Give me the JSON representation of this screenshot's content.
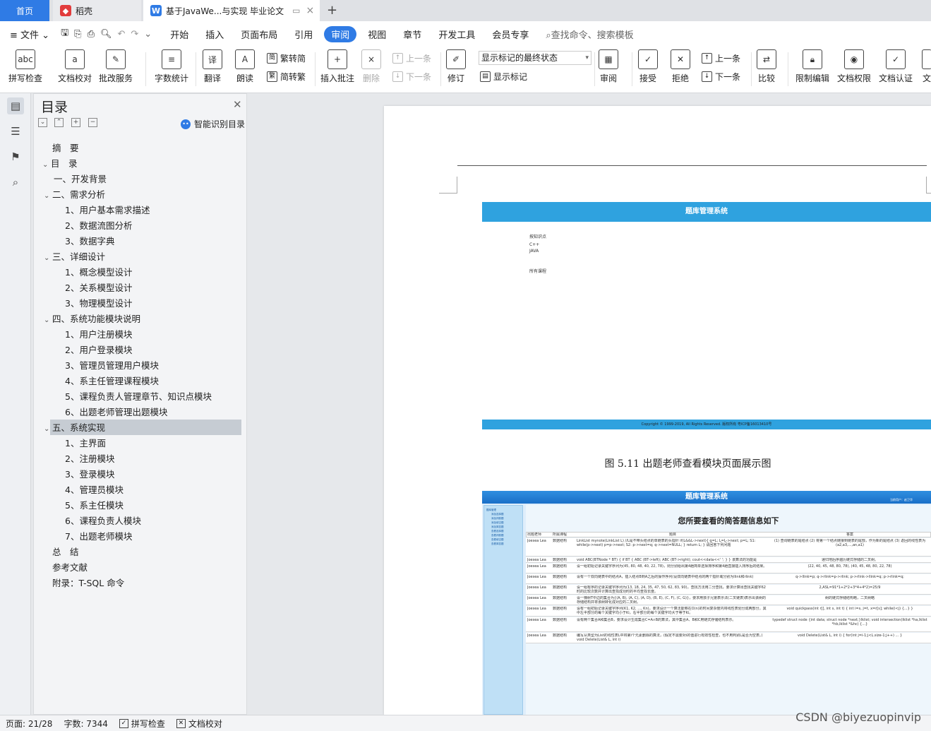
{
  "tabs": {
    "home": "首页",
    "shell": "稻壳",
    "doc": "基于JavaWe...与实现 毕业论文",
    "new_tab": "+"
  },
  "menu": {
    "file": "文件",
    "items": [
      "开始",
      "插入",
      "页面布局",
      "引用",
      "审阅",
      "视图",
      "章节",
      "开发工具",
      "会员专享"
    ],
    "search_placeholder": "查找命令、搜索模板"
  },
  "ribbon": {
    "spell": "拼写检查",
    "doc_check": "文档校对",
    "batch": "批改服务",
    "word_count": "字数统计",
    "translate": "翻译",
    "read_aloud": "朗读",
    "trad": "繁转简",
    "simp": "简转繁",
    "insert_comment": "插入批注",
    "delete": "删除",
    "prev": "上一条",
    "next": "下一条",
    "revise": "修订",
    "markup_state": "显示标记的最终状态",
    "show_markup": "显示标记",
    "review": "审阅",
    "accept": "接受",
    "reject": "拒绝",
    "prev2": "上一条",
    "next2": "下一条",
    "compare": "比较",
    "restrict": "限制编辑",
    "permission": "文档权限",
    "certify": "文档认证",
    "more": "文"
  },
  "toc": {
    "title": "目录",
    "smart": "智能识别目录",
    "items": [
      {
        "label": "摘　要",
        "level": 0,
        "caret": ""
      },
      {
        "label": "目　录",
        "level": 0,
        "caret": "v"
      },
      {
        "label": "一、开发背景",
        "level": 1,
        "caret": ""
      },
      {
        "label": "二、需求分析",
        "level": 1,
        "caret": "v"
      },
      {
        "label": "1、用户基本需求描述",
        "level": 2,
        "caret": ""
      },
      {
        "label": "2、数据流图分析",
        "level": 2,
        "caret": ""
      },
      {
        "label": "3、数据字典",
        "level": 2,
        "caret": ""
      },
      {
        "label": "三、详细设计",
        "level": 1,
        "caret": "v"
      },
      {
        "label": "1、概念模型设计",
        "level": 2,
        "caret": ""
      },
      {
        "label": "2、关系模型设计",
        "level": 2,
        "caret": ""
      },
      {
        "label": "3、物理模型设计",
        "level": 2,
        "caret": ""
      },
      {
        "label": "四、系统功能模块说明",
        "level": 1,
        "caret": "v"
      },
      {
        "label": "1、用户注册模块",
        "level": 2,
        "caret": ""
      },
      {
        "label": "2、用户登录模块",
        "level": 2,
        "caret": ""
      },
      {
        "label": "3、管理员管理用户模块",
        "level": 2,
        "caret": ""
      },
      {
        "label": "4、系主任管理课程模块",
        "level": 2,
        "caret": ""
      },
      {
        "label": "5、课程负责人管理章节、知识点模块",
        "level": 2,
        "caret": ""
      },
      {
        "label": "6、出题老师管理出题模块",
        "level": 2,
        "caret": ""
      },
      {
        "label": "五、系统实现",
        "level": 1,
        "caret": "v"
      },
      {
        "label": "1、主界面",
        "level": 2,
        "caret": ""
      },
      {
        "label": "2、注册模块",
        "level": 2,
        "caret": ""
      },
      {
        "label": "3、登录模块",
        "level": 2,
        "caret": ""
      },
      {
        "label": "4、管理员模块",
        "level": 2,
        "caret": ""
      },
      {
        "label": "5、系主任模块",
        "level": 2,
        "caret": ""
      },
      {
        "label": "6、课程负责人模块",
        "level": 2,
        "caret": ""
      },
      {
        "label": "7、出题老师模块",
        "level": 2,
        "caret": ""
      },
      {
        "label": "总　结",
        "level": 0,
        "caret": ""
      },
      {
        "label": "参考文献",
        "level": 0,
        "caret": ""
      },
      {
        "label": "附录：T-SQL 命令",
        "level": 0,
        "caret": ""
      }
    ]
  },
  "doc": {
    "shot1": {
      "header": "题库管理系统",
      "label1": "按知识点",
      "opt1": "C++",
      "opt2": "JAVA",
      "label2": "所有课程",
      "footer": "Copyright © 1999-2019, All Rights Reserved. 版权所有 粤ICP备16013410号"
    },
    "caption": "图 5.11 出题老师查看模块页面展示图",
    "shot2": {
      "header": "题库管理系统",
      "title": "您所要查看的简答题信息如下",
      "cols": [
        "出题老师",
        "所属课程",
        "题目",
        "答案"
      ],
      "rows": [
        [
          "Joesea Lea",
          "数据结构",
          "LinkList mynote(LinkList L) //L是不带头结点的单链表的头指针 if(L&&L->next){ q=L; L=L->next; p=L; S1: while(p->next) p=p->next; S2: p->next=q; q->next=NULL; } return L; } 请回答下列问题",
          "(1) 查询链表的尾结点 (2) 将第一个结点链接到链表的尾部，作为新的尾结点 (3) 返回的线性表为(a2,a3,...,an,a1)"
        ],
        [
          "Joesea Lea",
          "数据结构",
          "void ABC(BTNode * BT) { if BT { ABC (BT->left); ABC (BT->right); cout<<data<<' '; } } 该算法的功能是",
          "递归地后序遍历链式存储的二叉树。"
        ],
        [
          "Joesea Lea",
          "数据结构",
          "设一组初始记录关键字序列为(45, 80, 48, 40, 22, 78)，则分别给出第4趟简单选择排序和第4趟直接插入排序后的结果。",
          "(22, 40, 45, 48, 80, 78), (40, 45, 48, 80, 22, 78)"
        ],
        [
          "Joesea Lea",
          "数据结构",
          "设有一个双向链表中的结点A，插入结点B到A之后的操作序列(设双向链表中结点的两个指针域分别为llink和rlink)",
          "q->llink=p; q->rlink=p->rlink; p->rlink->llink=q; p->rlink=q;"
        ],
        [
          "Joesea Lea",
          "数据结构",
          "设一组有序的记录关键字序列为(13, 18, 24, 35, 47, 50, 62, 83, 90)，查找方法用二分查找，要求计算出查找关键字62时的比较次数并计算出查找成功时的平均查找长度。",
          "2,ASL=91*1+2*2+3*4+4*2)=25/9"
        ],
        [
          "Joesea Lea",
          "数据结构",
          "设一棵树T中边的集合为{(A, B), (A, C), (A, D), (B, E), (C, F), (C, G)}，要求用孩子兄弟表示法(二叉链表)表示出该树的存储结构并将该树转化成对应的二叉树。",
          "树的链式存储结构略，二叉树略"
        ],
        [
          "Joesea Lea",
          "数据结构",
          "设有一组初始记录关键字序列(K1, K2, ..., Kn)，要求设计一个算法能够在O(n)的时间复杂度内将线性表划分成两部分，其中左半部分的每个关键字均小于Ki，右半部分的每个关键字均大于等于Ki。",
          "void quickpass(int r[], int s, int t) { int i=s, j=t, x=r[s]; while(i<j) {...} }"
        ],
        [
          "Joesea Lea",
          "数据结构",
          "设有两个集合A和集合B，要求设计生成集合C=A∩B的算法，其中集合A、B和C用链式存储结构表示。",
          "typedef struct node {int data; struct node *next;}lklist; void intersection(lklist *ha,lklist *hb,lklist *&hc) {...}"
        ],
        [
          "Joesea Lea",
          "数据结构",
          "编写从类型为List的线性表L中将第i个元素删除的算法，(假定不需要对i的值进行有效性检查，也不用判别L是否为空表。) void Delete(List& L, int i)",
          "void Delete(List& L, int i) { for(int j=i-1;j<L.size-1;j++) ... }"
        ]
      ],
      "sidebar_items": [
        "题库管理",
        "添加选择题",
        "添加判断题",
        "添加填空题",
        "添加简答题",
        "查看选择题",
        "查看判断题",
        "查看填空题",
        "查看简答题"
      ],
      "user_text": "当前用户：赵卫华"
    }
  },
  "status": {
    "page": "页面: 21/28",
    "words": "字数: 7344",
    "spell": "拼写检查",
    "doc_check": "文档校对"
  },
  "watermark": "CSDN @biyezuopinvip"
}
